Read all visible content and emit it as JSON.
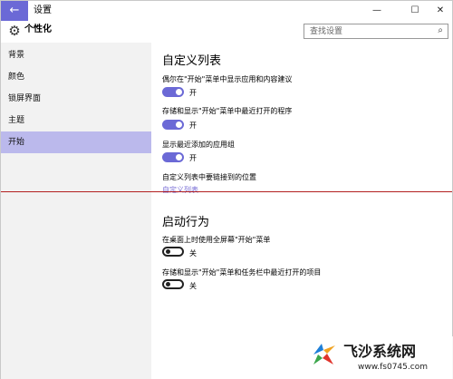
{
  "window": {
    "title": "设置",
    "back_icon": "left-arrow-icon",
    "minimize_glyph": "—",
    "maximize_glyph": "☐",
    "close_glyph": "✕"
  },
  "header": {
    "title": "个性化",
    "icon": "gear-icon",
    "search_placeholder": "查找设置"
  },
  "sidebar": {
    "items": [
      {
        "label": "背景",
        "active": false
      },
      {
        "label": "颜色",
        "active": false
      },
      {
        "label": "锁屏界面",
        "active": false
      },
      {
        "label": "主题",
        "active": false
      },
      {
        "label": "开始",
        "active": true
      }
    ]
  },
  "main": {
    "custom_list": {
      "title": "自定义列表",
      "settings": [
        {
          "label": "偶尔在\"开始\"菜单中显示应用和内容建议",
          "state": "开",
          "on": true
        },
        {
          "label": "存储和显示\"开始\"菜单中最近打开的程序",
          "state": "开",
          "on": true
        },
        {
          "label": "显示最近添加的应用组",
          "state": "开",
          "on": true
        }
      ],
      "choose_folders_label": "自定义列表中要链接到的位置",
      "choose_folders_link": "自定义列表"
    },
    "startup": {
      "title": "启动行为",
      "settings": [
        {
          "label": "在桌面上时使用全屏幕\"开始\"菜单",
          "state": "关",
          "on": false
        },
        {
          "label": "存储和显示\"开始\"菜单和任务栏中最近打开的项目",
          "state": "关",
          "on": false
        }
      ]
    }
  },
  "watermark": {
    "name": "飞沙系统网",
    "url": "www.fs0745.com"
  },
  "colors": {
    "accent": "#6b69d6",
    "sidebar_bg": "#f2f2f2",
    "active_item_bg": "#bbb9ec",
    "annotation_line": "#b32020"
  }
}
